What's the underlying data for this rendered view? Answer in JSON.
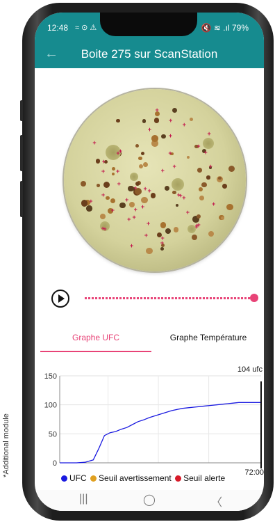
{
  "side_caption": "*Additional module",
  "status": {
    "time": "12:48",
    "left_icons": "≈ ⊙ ⚠",
    "right": "🔇 ≋ .ıl 79%"
  },
  "app_bar": {
    "title": "Boite 275 sur ScanStation"
  },
  "tabs": [
    {
      "label": "Graphe UFC",
      "active": true
    },
    {
      "label": "Graphe Température",
      "active": false
    }
  ],
  "playback": {
    "progress": 1.0
  },
  "colors": {
    "accent": "#168b8f",
    "highlight": "#e84377",
    "ufc": "#1a1ae0",
    "warning": "#e0a020",
    "alert": "#d81b2a"
  },
  "chart_data": {
    "type": "line",
    "series": [
      {
        "name": "UFC",
        "x": [
          0,
          3,
          6,
          9,
          12,
          14,
          16,
          18,
          20,
          22,
          24,
          26,
          28,
          30,
          32,
          34,
          36,
          38,
          40,
          42,
          44,
          46,
          48,
          50,
          52,
          54,
          56,
          58,
          60,
          62,
          64,
          66,
          68,
          70,
          72
        ],
        "values": [
          0,
          0,
          0,
          1,
          5,
          25,
          47,
          52,
          54,
          58,
          61,
          66,
          71,
          74,
          78,
          81,
          84,
          87,
          90,
          92,
          94,
          95,
          96,
          97,
          98,
          99,
          100,
          101,
          102,
          103,
          104,
          104,
          104,
          104,
          104
        ]
      }
    ],
    "y_ticks": [
      "150",
      "100",
      "50",
      "0"
    ],
    "ylim": [
      0,
      150
    ],
    "x_end_label": "72:00",
    "last_value_label": "104 ufc",
    "grid": true,
    "legend": [
      {
        "name": "UFC",
        "color": "#1a1ae0"
      },
      {
        "name": "Seuil avertissement",
        "color": "#e0a020"
      },
      {
        "name": "Seuil alerte",
        "color": "#d81b2a"
      }
    ]
  },
  "nav": {
    "recent": "|||",
    "home": "◯",
    "back": "〈"
  }
}
